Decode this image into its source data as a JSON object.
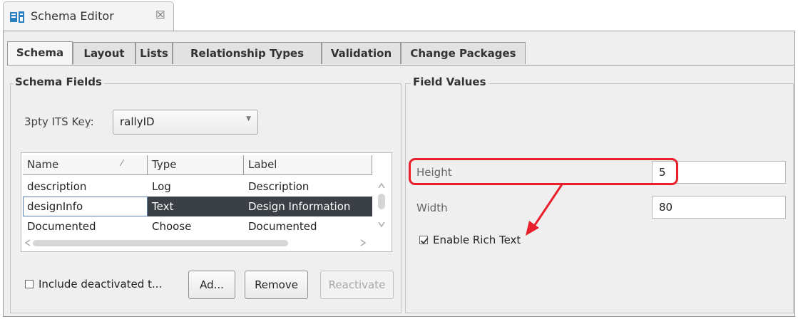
{
  "window": {
    "tab_title": "Schema Editor",
    "close_symbol": "☒"
  },
  "tabs": [
    {
      "label": "Schema",
      "active": true
    },
    {
      "label": "Layout",
      "active": false
    },
    {
      "label": "Lists",
      "active": false
    },
    {
      "label": "Relationship Types",
      "active": false
    },
    {
      "label": "Validation",
      "active": false
    },
    {
      "label": "Change Packages",
      "active": false
    }
  ],
  "schema_fields": {
    "title": "Schema Fields",
    "key_label": "3pty ITS Key:",
    "key_value": "rallyID",
    "table": {
      "columns": [
        "Name",
        "Type",
        "Label"
      ],
      "rows": [
        {
          "name": "description",
          "type": "Log",
          "label": "Description"
        },
        {
          "name": "designInfo",
          "type": "Text",
          "label": "Design Information",
          "selected": true
        },
        {
          "name": "Documented",
          "type": "Choose",
          "label": "Documented"
        }
      ]
    },
    "include_deactivated_label": "Include deactivated t...",
    "include_deactivated_checked": false,
    "buttons": {
      "add": "Ad...",
      "remove": "Remove",
      "reactivate": "Reactivate"
    }
  },
  "field_values": {
    "title": "Field Values",
    "height_label": "Height",
    "height_value": "5",
    "width_label": "Width",
    "width_value": "80",
    "rich_text_label": "Enable Rich Text",
    "rich_text_checked": true
  },
  "colors": {
    "annotation": "#e8202a",
    "selection": "#3b3f46"
  }
}
